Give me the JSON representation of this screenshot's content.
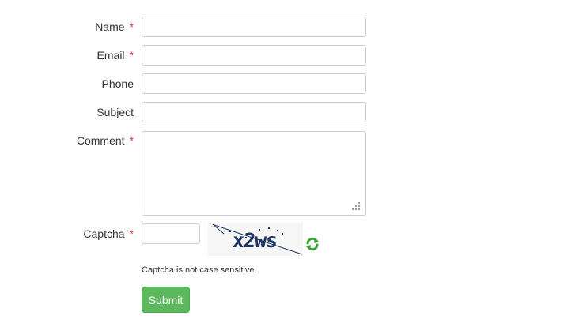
{
  "form": {
    "fields": [
      {
        "label": "Name",
        "required": true,
        "value": ""
      },
      {
        "label": "Email",
        "required": true,
        "value": ""
      },
      {
        "label": "Phone",
        "required": false,
        "value": ""
      },
      {
        "label": "Subject",
        "required": false,
        "value": ""
      },
      {
        "label": "Comment",
        "required": true,
        "value": ""
      }
    ],
    "required_marker": "*",
    "captcha": {
      "label": "Captcha",
      "required": true,
      "value": "",
      "image_text": "x2ws",
      "hint": "Captcha is not case sensitive.",
      "refresh_icon": "refresh-icon"
    },
    "submit_label": "Submit"
  },
  "colors": {
    "required": "#d9312a",
    "submit_bg": "#5cb85c",
    "captcha_text": "#1f3563",
    "refresh_icon": "#3aa13a"
  }
}
